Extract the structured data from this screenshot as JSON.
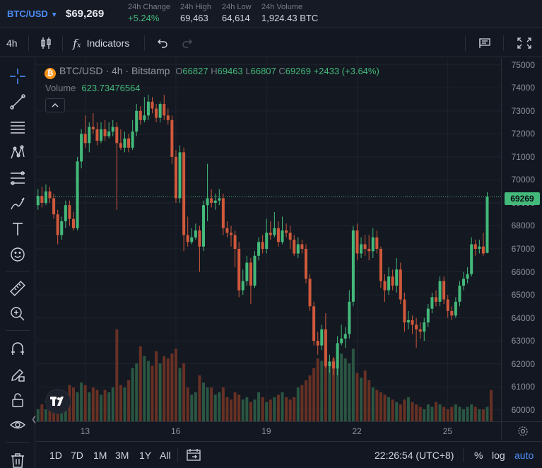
{
  "header": {
    "pair": "BTC/USD",
    "price": "$69,269",
    "stats": [
      {
        "label": "24h Change",
        "value": "+5.24%",
        "up": true
      },
      {
        "label": "24h High",
        "value": "69,463",
        "up": false
      },
      {
        "label": "24h Low",
        "value": "64,614",
        "up": false
      },
      {
        "label": "24h Volume",
        "value": "1,924.43 BTC",
        "up": false
      }
    ]
  },
  "toolbar": {
    "interval": "4h",
    "indicators_label": "Indicators"
  },
  "legend": {
    "symbol": "BTC/USD",
    "interval": "4h",
    "exchange": "Bitstamp",
    "open_label": "O",
    "open": "66827",
    "high_label": "H",
    "high": "69463",
    "low_label": "L",
    "low": "66807",
    "close_label": "C",
    "close": "69269",
    "change": "+2433 (+3.64%)",
    "volume_label": "Volume",
    "volume": "623.73476564"
  },
  "last_price_label": "69269",
  "bottom": {
    "ranges": [
      "1D",
      "7D",
      "1M",
      "3M",
      "1Y",
      "All"
    ],
    "time": "22:26:54 (UTC+8)",
    "percent": "%",
    "log": "log",
    "auto": "auto"
  },
  "colors": {
    "up": "#43b97a",
    "down": "#d0593b",
    "accent": "#4b8cf5"
  },
  "chart_data": {
    "type": "candlestick",
    "y_ticks": [
      75000,
      74000,
      73000,
      72000,
      71000,
      70000,
      69000,
      68000,
      67000,
      66000,
      65000,
      64000,
      63000,
      62000,
      61000,
      60000
    ],
    "ylim": [
      59500,
      75300
    ],
    "x_ticks": [
      "13",
      "16",
      "19",
      "22",
      "25"
    ],
    "last_close": 69269,
    "candles": [
      [
        68900,
        69300,
        69600,
        68700
      ],
      [
        69300,
        69000,
        69700,
        68800
      ],
      [
        69000,
        69500,
        69800,
        68900
      ],
      [
        69500,
        69200,
        69700,
        69000
      ],
      [
        69200,
        68500,
        69400,
        68300
      ],
      [
        68500,
        67600,
        68700,
        67200
      ],
      [
        67600,
        68200,
        68400,
        67400
      ],
      [
        68200,
        68900,
        69100,
        67900
      ],
      [
        68900,
        68300,
        69100,
        68000
      ],
      [
        68300,
        67900,
        68600,
        67800
      ],
      [
        67900,
        70800,
        71000,
        67800
      ],
      [
        70800,
        72000,
        72200,
        70500
      ],
      [
        72000,
        71600,
        72800,
        71400
      ],
      [
        71600,
        72300,
        72500,
        71200
      ],
      [
        72300,
        72200,
        72900,
        72000
      ],
      [
        72200,
        71700,
        72500,
        71500
      ],
      [
        71700,
        72200,
        72500,
        71600
      ],
      [
        72200,
        71900,
        72600,
        71700
      ],
      [
        71900,
        72100,
        72500,
        71800
      ],
      [
        72100,
        72300,
        72600,
        71900
      ],
      [
        72300,
        71600,
        72500,
        68700
      ],
      [
        71600,
        71400,
        72200,
        71300
      ],
      [
        71400,
        71800,
        72100,
        71200
      ],
      [
        71800,
        71400,
        72000,
        71200
      ],
      [
        71400,
        72100,
        72600,
        71300
      ],
      [
        72100,
        73000,
        73300,
        71900
      ],
      [
        73000,
        72600,
        73200,
        72400
      ],
      [
        72600,
        72800,
        73600,
        72500
      ],
      [
        72800,
        73400,
        73700,
        72600
      ],
      [
        73400,
        73100,
        73600,
        72900
      ],
      [
        73100,
        72700,
        73300,
        72500
      ],
      [
        72700,
        73300,
        73400,
        72500
      ],
      [
        73300,
        72800,
        73700,
        72600
      ],
      [
        72800,
        72600,
        73100,
        72400
      ],
      [
        72600,
        71000,
        72800,
        70700
      ],
      [
        71000,
        69200,
        71300,
        69000
      ],
      [
        69200,
        71200,
        71500,
        69000
      ],
      [
        71200,
        67600,
        71400,
        66900
      ],
      [
        67600,
        67300,
        68400,
        67100
      ],
      [
        67300,
        67500,
        67900,
        67200
      ],
      [
        67500,
        67800,
        68100,
        67400
      ],
      [
        67800,
        67100,
        68000,
        66000
      ],
      [
        67100,
        68900,
        69100,
        66900
      ],
      [
        68900,
        69200,
        70700,
        68200
      ],
      [
        69200,
        69000,
        69600,
        68800
      ],
      [
        69000,
        69100,
        69400,
        68700
      ],
      [
        69100,
        69200,
        69600,
        68900
      ],
      [
        69200,
        67900,
        69400,
        67600
      ],
      [
        67900,
        67700,
        68200,
        67500
      ],
      [
        67700,
        67600,
        68000,
        67100
      ],
      [
        67600,
        67000,
        67800,
        66200
      ],
      [
        67000,
        65200,
        67300,
        64900
      ],
      [
        65200,
        65600,
        66100,
        65000
      ],
      [
        65600,
        66400,
        66700,
        65400
      ],
      [
        66400,
        65400,
        66600,
        64600
      ],
      [
        65400,
        66700,
        66900,
        65300
      ],
      [
        66700,
        67300,
        67500,
        66500
      ],
      [
        67300,
        67000,
        67600,
        66800
      ],
      [
        67000,
        67700,
        68300,
        66800
      ],
      [
        67700,
        67600,
        68200,
        67400
      ],
      [
        67600,
        67900,
        68600,
        67500
      ],
      [
        67900,
        67300,
        68200,
        67100
      ],
      [
        67300,
        67800,
        68400,
        67200
      ],
      [
        67800,
        67700,
        68100,
        67500
      ],
      [
        67700,
        67400,
        68000,
        67000
      ],
      [
        67400,
        66800,
        67600,
        66700
      ],
      [
        66800,
        67200,
        67500,
        66600
      ],
      [
        67200,
        67000,
        67400,
        66800
      ],
      [
        67000,
        65700,
        67200,
        65500
      ],
      [
        65700,
        64500,
        65900,
        64300
      ],
      [
        64500,
        63000,
        64700,
        62800
      ],
      [
        63000,
        62800,
        63400,
        62400
      ],
      [
        62800,
        63500,
        63700,
        62600
      ],
      [
        63500,
        61900,
        64200,
        61800
      ],
      [
        61900,
        62100,
        62400,
        61600
      ],
      [
        62100,
        61800,
        62300,
        61500
      ],
      [
        61800,
        62900,
        63200,
        61500
      ],
      [
        62900,
        63100,
        63700,
        62800
      ],
      [
        63100,
        63300,
        63600,
        62700
      ],
      [
        63300,
        64700,
        65200,
        63100
      ],
      [
        64700,
        67800,
        68000,
        64500
      ],
      [
        67800,
        66800,
        68100,
        66500
      ],
      [
        66800,
        67200,
        67500,
        66600
      ],
      [
        67200,
        67000,
        67600,
        66700
      ],
      [
        67000,
        66900,
        67600,
        66500
      ],
      [
        66900,
        67500,
        67900,
        66600
      ],
      [
        67500,
        67000,
        67800,
        66800
      ],
      [
        67000,
        65600,
        67100,
        65300
      ],
      [
        65600,
        65200,
        65900,
        64700
      ],
      [
        65200,
        65800,
        66200,
        65000
      ],
      [
        65800,
        65400,
        66100,
        65200
      ],
      [
        65400,
        66100,
        66600,
        65100
      ],
      [
        66100,
        64800,
        66400,
        64600
      ],
      [
        64800,
        63800,
        65100,
        63400
      ],
      [
        63800,
        63900,
        64300,
        63500
      ],
      [
        63900,
        63700,
        64100,
        63300
      ],
      [
        63700,
        63500,
        64000,
        62700
      ],
      [
        63500,
        63400,
        63800,
        63100
      ],
      [
        63400,
        63800,
        64000,
        63000
      ],
      [
        63800,
        64400,
        64600,
        63600
      ],
      [
        64400,
        64900,
        65100,
        64200
      ],
      [
        64900,
        64700,
        65200,
        64500
      ],
      [
        64700,
        65600,
        65800,
        64500
      ],
      [
        65600,
        64800,
        65800,
        64600
      ],
      [
        64800,
        64300,
        65000,
        64000
      ],
      [
        64300,
        64100,
        64500,
        63900
      ],
      [
        64100,
        64700,
        64900,
        64000
      ],
      [
        64700,
        65400,
        65600,
        64500
      ],
      [
        65400,
        65700,
        66000,
        65200
      ],
      [
        65700,
        65900,
        66200,
        65500
      ],
      [
        65900,
        67200,
        67500,
        65800
      ],
      [
        67200,
        67000,
        67400,
        66700
      ],
      [
        67000,
        67100,
        67400,
        66800
      ],
      [
        67100,
        66800,
        67700,
        66700
      ],
      [
        66827,
        69269,
        69463,
        66807
      ]
    ],
    "volumes": [
      5,
      7,
      5,
      6,
      9,
      8,
      10,
      11,
      15,
      14,
      12,
      16,
      15,
      12,
      14,
      13,
      11,
      13,
      12,
      14,
      38,
      15,
      14,
      17,
      22,
      24,
      31,
      27,
      25,
      23,
      29,
      24,
      27,
      26,
      28,
      30,
      22,
      24,
      14,
      11,
      12,
      19,
      16,
      14,
      14,
      11,
      12,
      14,
      10,
      9,
      12,
      11,
      9,
      10,
      8,
      9,
      12,
      10,
      8,
      9,
      10,
      11,
      12,
      10,
      9,
      10,
      14,
      15,
      17,
      19,
      22,
      26,
      25,
      30,
      24,
      26,
      22,
      28,
      26,
      24,
      30,
      20,
      18,
      21,
      17,
      14,
      13,
      12,
      11,
      10,
      9,
      8,
      7,
      9,
      10,
      8,
      7,
      6,
      5,
      7,
      6,
      8,
      7,
      6,
      5,
      6,
      7,
      6,
      5,
      6,
      7,
      6,
      5,
      5,
      6,
      13
    ]
  }
}
